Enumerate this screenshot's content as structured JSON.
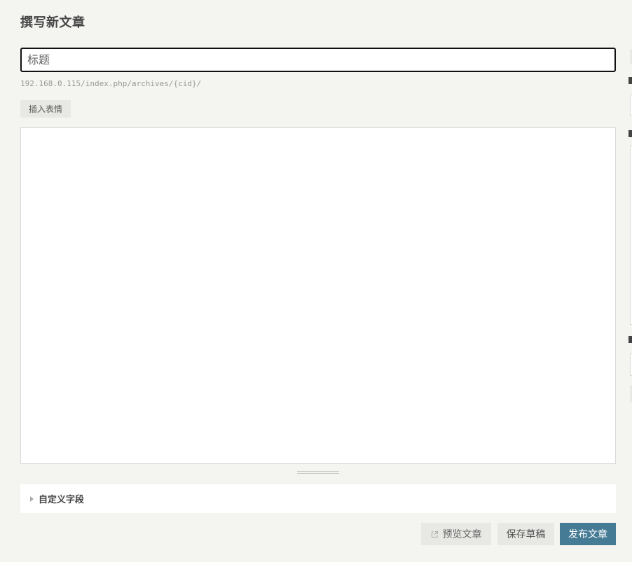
{
  "page": {
    "title": "撰写新文章"
  },
  "editor": {
    "title_placeholder": "标题",
    "title_value": "",
    "permalink": "192.168.0.115/index.php/archives/{cid}/",
    "insert_emoji_label": "插入表情",
    "content_value": ""
  },
  "custom_fields": {
    "label": "自定义字段"
  },
  "actions": {
    "preview_label": "预览文章",
    "save_draft_label": "保存草稿",
    "publish_label": "发布文章"
  },
  "colors": {
    "background": "#f4f4f1",
    "primary_button": "#467b96",
    "secondary_button": "#e8e8e5"
  },
  "icons": {
    "preview": "external-link-icon",
    "custom_fields_toggle": "triangle-right-icon"
  }
}
